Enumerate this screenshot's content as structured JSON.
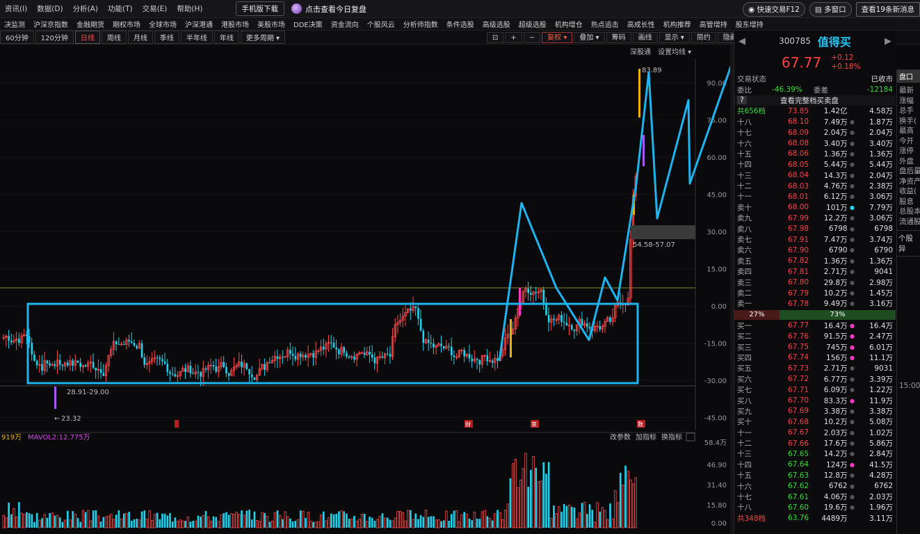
{
  "menu": {
    "items": [
      "资讯(I)",
      "数据(D)",
      "分析(A)",
      "功能(T)",
      "交易(E)",
      "帮助(H)"
    ],
    "mobile_download": "手机版下载",
    "promo": "点击查看今日复盘",
    "quick_trade": "快速交易F12",
    "multi_window": "多窗口",
    "news": "查看19条新消息"
  },
  "nav": [
    "决监测",
    "沪深京指数",
    "金融期货",
    "期权市场",
    "全球市场",
    "沪深港通",
    "港股市场",
    "美股市场",
    "DDE决策",
    "资金流向",
    "个股风云",
    "分析师指数",
    "条件选股",
    "高级选股",
    "超级选股",
    "机构增仓",
    "热点追击",
    "高成长性",
    "机构推荐",
    "高管增持",
    "股东增持"
  ],
  "periods": {
    "items": [
      "60分钟",
      "120分钟",
      "日线",
      "周线",
      "月线",
      "季线",
      "半年线",
      "年线",
      "更多周期 ▾"
    ],
    "active": "日线"
  },
  "chart_tools": [
    "⊡",
    "+",
    "−",
    "复权 ▾",
    "叠加 ▾",
    "筹码",
    "画线",
    "显示 ▾",
    "简约",
    "隐藏 ▸▸",
    "⛶"
  ],
  "chart_header": {
    "depth": "深股通",
    "settings": "设置均线 ▾"
  },
  "chart_data": {
    "type": "candlestick",
    "y_axis_ticks": [
      "90.00",
      "75.00",
      "60.00",
      "45.00",
      "30.00",
      "15.00",
      "0.00",
      "-15.00",
      "-30.00",
      "-45.00"
    ],
    "annotations": {
      "high": "83.89",
      "low": "23.32",
      "low_range": "28.91-29.00",
      "gap_range": "54.58-57.07"
    },
    "event_markers": [
      "财",
      "束",
      "数"
    ],
    "volume": {
      "mavol1": "919万",
      "mavol2": "MAVOL2:12.775万",
      "y_ticks": [
        "58.4万",
        "46.90",
        "31.40",
        "15.80",
        "0.00"
      ],
      "tools": [
        "改参数",
        "加指标",
        "换指标"
      ]
    },
    "overlay": {
      "rectangle_color": "#1eb4f0",
      "trend_line_color": "#1eb4f0"
    }
  },
  "stock": {
    "code": "300785",
    "name": "值得买",
    "price": "67.77",
    "change": "+0.12",
    "change_pct": "+0.18%"
  },
  "orderbook": {
    "status_label": "交易状态",
    "status_value": "已收市",
    "wei_bi_label": "委比",
    "wei_bi_value": "-46.39%",
    "wei_cha_label": "委差",
    "wei_cha_value": "-12184",
    "full_book": "查看完整档买卖盘",
    "total_sell_label": "共656档",
    "total_sell": [
      "73.85",
      "1.42亿",
      "4.58万"
    ],
    "asks": [
      [
        "十八",
        "68.10",
        "7.49万",
        "1.87万",
        ""
      ],
      [
        "十七",
        "68.09",
        "2.04万",
        "2.04万",
        ""
      ],
      [
        "十六",
        "68.08",
        "3.40万",
        "3.40万",
        ""
      ],
      [
        "十五",
        "68.06",
        "1.36万",
        "1.36万",
        ""
      ],
      [
        "十四",
        "68.05",
        "5.44万",
        "5.44万",
        ""
      ],
      [
        "十三",
        "68.04",
        "14.3万",
        "2.04万",
        ""
      ],
      [
        "十二",
        "68.03",
        "4.76万",
        "2.38万",
        ""
      ],
      [
        "十一",
        "68.01",
        "6.12万",
        "3.06万",
        ""
      ],
      [
        "卖十",
        "68.00",
        "101万",
        "7.79万",
        "cy"
      ],
      [
        "卖九",
        "67.99",
        "12.2万",
        "3.06万",
        ""
      ],
      [
        "卖八",
        "67.98",
        "6798",
        "6798",
        ""
      ],
      [
        "卖七",
        "67.91",
        "7.47万",
        "3.74万",
        ""
      ],
      [
        "卖六",
        "67.90",
        "6790",
        "6790",
        ""
      ],
      [
        "卖五",
        "67.82",
        "1.36万",
        "1.36万",
        ""
      ],
      [
        "卖四",
        "67.81",
        "2.71万",
        "9041",
        ""
      ],
      [
        "卖三",
        "67.80",
        "29.8万",
        "2.98万",
        ""
      ],
      [
        "卖二",
        "67.79",
        "10.2万",
        "1.45万",
        ""
      ],
      [
        "卖一",
        "67.78",
        "9.49万",
        "3.16万",
        ""
      ]
    ],
    "ratio_sell": "27%",
    "ratio_buy": "73%",
    "bids": [
      [
        "买一",
        "67.77",
        "16.4万",
        "16.4万",
        "mg",
        "r"
      ],
      [
        "买二",
        "67.76",
        "91.5万",
        "2.47万",
        "mg",
        "r"
      ],
      [
        "买三",
        "67.75",
        "745万",
        "6.01万",
        "mg",
        "r"
      ],
      [
        "买四",
        "67.74",
        "156万",
        "11.1万",
        "mg",
        "r"
      ],
      [
        "买五",
        "67.73",
        "2.71万",
        "9031",
        "",
        "r"
      ],
      [
        "买六",
        "67.72",
        "6.77万",
        "3.39万",
        "",
        "r"
      ],
      [
        "买七",
        "67.71",
        "6.09万",
        "1.22万",
        "",
        "r"
      ],
      [
        "买八",
        "67.70",
        "83.3万",
        "11.9万",
        "mg",
        "r"
      ],
      [
        "买九",
        "67.69",
        "3.38万",
        "3.38万",
        "",
        "r"
      ],
      [
        "买十",
        "67.68",
        "10.2万",
        "5.08万",
        "",
        "r"
      ],
      [
        "十一",
        "67.67",
        "2.03万",
        "1.02万",
        "",
        "r"
      ],
      [
        "十二",
        "67.66",
        "17.6万",
        "5.86万",
        "",
        "r"
      ],
      [
        "十三",
        "67.65",
        "14.2万",
        "2.84万",
        "",
        "g"
      ],
      [
        "十四",
        "67.64",
        "124万",
        "41.5万",
        "mg",
        "g"
      ],
      [
        "十五",
        "67.63",
        "12.8万",
        "4.28万",
        "",
        "g"
      ],
      [
        "十六",
        "67.62",
        "6762",
        "6762",
        "",
        "g"
      ],
      [
        "十七",
        "67.61",
        "4.06万",
        "2.03万",
        "",
        "g"
      ],
      [
        "十八",
        "67.60",
        "19.6万",
        "1.96万",
        "",
        "g"
      ]
    ],
    "total_buy_label": "共348档",
    "total_buy": [
      "63.76",
      "4489万",
      "3.11万"
    ]
  },
  "side_panel": {
    "tab": "盘口",
    "items": [
      "最新",
      "涨幅",
      "总手",
      "换手(",
      "最高",
      "今开",
      "涨停",
      "外盘",
      "盘后量",
      "净资产",
      "收益(",
      "股息",
      "总股本",
      "流通股"
    ],
    "box": "个股异",
    "time": "15:00"
  }
}
